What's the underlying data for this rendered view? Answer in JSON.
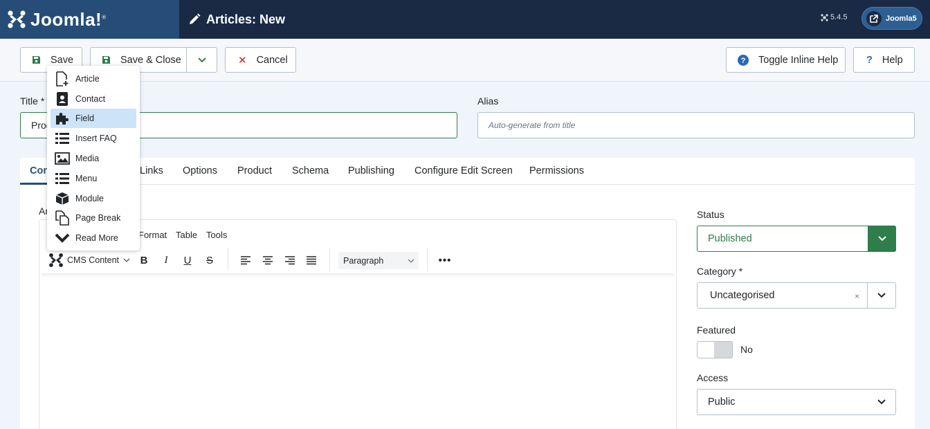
{
  "header": {
    "logo_text": "Joomla!",
    "page_title": "Articles: New",
    "version": "5.4.5",
    "site_button": "Joomla5"
  },
  "toolbar": {
    "save": "Save",
    "save_close": "Save & Close",
    "cancel": "Cancel",
    "toggle_help": "Toggle Inline Help",
    "help": "Help"
  },
  "form": {
    "title_label": "Title *",
    "title_value": "Prod",
    "alias_label": "Alias",
    "alias_placeholder": "Auto-generate from title"
  },
  "tabs": [
    "Con",
    "Links",
    "Options",
    "Product",
    "Schema",
    "Publishing",
    "Configure Edit Screen",
    "Permissions"
  ],
  "editor": {
    "label_fragment": "Ar",
    "menubar": [
      "Format",
      "Table",
      "Tools"
    ],
    "cms_content": "CMS Content",
    "paragraph": "Paragraph"
  },
  "dropdown": {
    "items": [
      "Article",
      "Contact",
      "Field",
      "Insert FAQ",
      "Media",
      "Menu",
      "Module",
      "Page Break",
      "Read More"
    ],
    "highlighted": "Field"
  },
  "sidebar": {
    "status_label": "Status",
    "status_value": "Published",
    "category_label": "Category *",
    "category_value": "Uncategorised",
    "featured_label": "Featured",
    "featured_value": "No",
    "access_label": "Access",
    "access_value": "Public"
  },
  "colors": {
    "header_bg": "#1a2a45",
    "logo_bg": "#254d77",
    "success": "#2f7d4a",
    "cancel_red": "#c52827",
    "highlight": "#cce3f8"
  }
}
